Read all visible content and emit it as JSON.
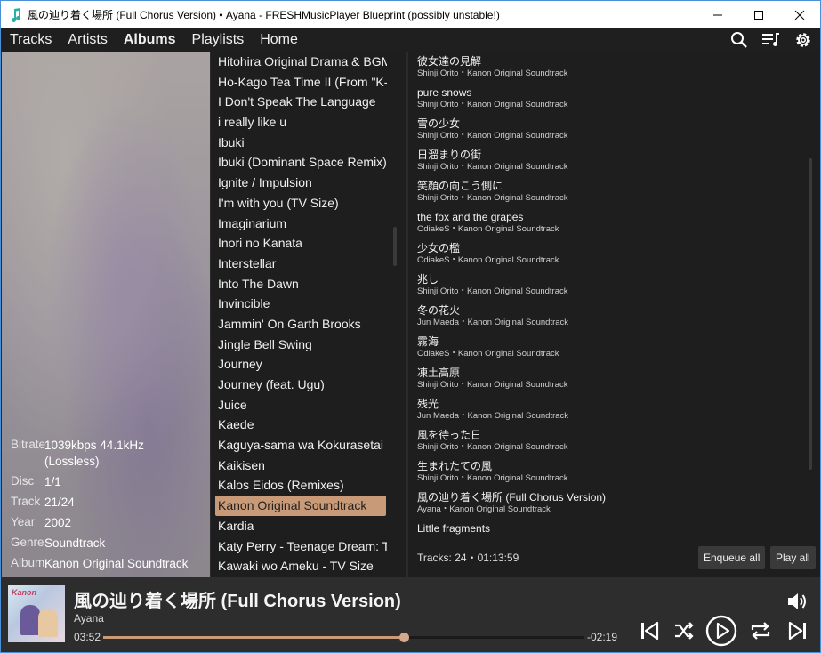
{
  "window": {
    "title": "風の辿り着く場所 (Full Chorus Version) • Ayana - FRESHMusicPlayer Blueprint (possibly unstable!)"
  },
  "menu": {
    "tabs": [
      "Tracks",
      "Artists",
      "Albums",
      "Playlists",
      "Home"
    ],
    "active_tab": "Albums",
    "icons": [
      "search-icon",
      "queue-icon",
      "gear-icon"
    ]
  },
  "metadata": {
    "bitrate_label": "Bitrate",
    "bitrate_value": "1039kbps 44.1kHz (Lossless)",
    "disc_label": "Disc",
    "disc_value": "1/1",
    "track_label": "Track",
    "track_value": "21/24",
    "year_label": "Year",
    "year_value": "2002",
    "genre_label": "Genre",
    "genre_value": "Soundtrack",
    "album_label": "Album",
    "album_value": "Kanon Original Soundtrack"
  },
  "albums": {
    "items": [
      "Hitohira Original Drama & BGM",
      "Ho-Kago Tea Time II (From \"K-On!!\")",
      "I Don't Speak The Language",
      "i really like u",
      "Ibuki",
      "Ibuki (Dominant Space Remix)",
      "Ignite / Impulsion",
      "I'm with you (TV Size)",
      "Imaginarium",
      "Inori no Kanata",
      "Interstellar",
      "Into The Dawn",
      "Invincible",
      "Jammin' On Garth Brooks",
      "Jingle Bell Swing",
      "Journey",
      "Journey (feat. Ugu)",
      "Juice",
      "Kaede",
      "Kaguya-sama wa Kokurasetai",
      "Kaikisen",
      "Kalos Eidos (Remixes)",
      "Kanon Original Soundtrack",
      "Kardia",
      "Katy Perry - Teenage Dream: The Complete Confection",
      "Kawaki wo Ameku - TV Size"
    ],
    "selected_index": 22
  },
  "tracks": {
    "items": [
      {
        "title": "彼女達の見解",
        "sub": "Shinji Orito・Kanon Original Soundtrack"
      },
      {
        "title": "pure snows",
        "sub": "Shinji Orito・Kanon Original Soundtrack"
      },
      {
        "title": "雪の少女",
        "sub": "Shinji Orito・Kanon Original Soundtrack"
      },
      {
        "title": "日溜まりの街",
        "sub": "Shinji Orito・Kanon Original Soundtrack"
      },
      {
        "title": "笑顔の向こう側に",
        "sub": "Shinji Orito・Kanon Original Soundtrack"
      },
      {
        "title": "the fox and the grapes",
        "sub": "OdiakeS・Kanon Original Soundtrack"
      },
      {
        "title": "少女の檻",
        "sub": "OdiakeS・Kanon Original Soundtrack"
      },
      {
        "title": "兆し",
        "sub": "Shinji Orito・Kanon Original Soundtrack"
      },
      {
        "title": "冬の花火",
        "sub": "Jun Maeda・Kanon Original Soundtrack"
      },
      {
        "title": "霧海",
        "sub": "OdiakeS・Kanon Original Soundtrack"
      },
      {
        "title": "凍土高原",
        "sub": "Shinji Orito・Kanon Original Soundtrack"
      },
      {
        "title": "残光",
        "sub": "Jun Maeda・Kanon Original Soundtrack"
      },
      {
        "title": "風を待った日",
        "sub": "Shinji Orito・Kanon Original Soundtrack"
      },
      {
        "title": "生まれたての風",
        "sub": "Shinji Orito・Kanon Original Soundtrack"
      },
      {
        "title": "風の辿り着く場所 (Full Chorus Version)",
        "sub": "Ayana・Kanon Original Soundtrack"
      },
      {
        "title": "Little fragments",
        "sub": ""
      }
    ],
    "summary": "Tracks: 24・01:13:59",
    "enqueue_label": "Enqueue all",
    "play_label": "Play all"
  },
  "player": {
    "cover_text": "Kanon",
    "song": "風の辿り着く場所 (Full Chorus Version)",
    "artist": "Ayana",
    "elapsed": "03:52",
    "remaining": "-02:19",
    "progress": 0.625,
    "accent": "#c89a78"
  }
}
